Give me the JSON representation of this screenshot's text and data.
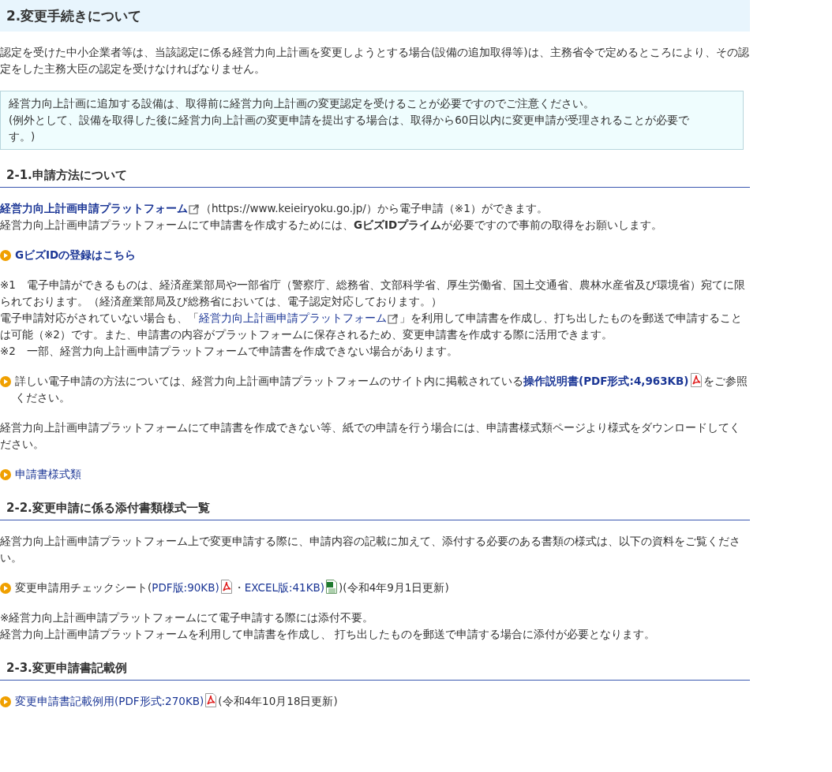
{
  "blocks": [
    {
      "kind": "h2",
      "text": "2.変更手続きについて"
    },
    {
      "kind": "para",
      "lines": [
        [
          {
            "kind": "text",
            "text": "認定を受けた中小企業者等は、当該認定に係る経営力向上計画を変更しようとする場合(設備の追加取得等)は、主務省令で定めるところにより、その認定をした主務大臣の認定を受けなければなりません。"
          }
        ]
      ]
    },
    {
      "kind": "note",
      "lines": [
        [
          {
            "kind": "text",
            "text": "経営力向上計画に追加する設備は、取得前に経営力向上計画の変更認定を受けることが必要ですのでご注意ください。"
          }
        ],
        [
          {
            "kind": "text",
            "text": "(例外として、設備を取得した後に経営力向上計画の変更申請を提出する場合は、取得から60日以内に変更申請が受理されることが必要です。)"
          }
        ]
      ]
    },
    {
      "kind": "h3",
      "text": "2-1.申請方法について"
    },
    {
      "kind": "para",
      "lines": [
        [
          {
            "kind": "link",
            "text": "経営力向上計画申請プラットフォーム",
            "bold": true
          },
          {
            "kind": "external"
          },
          {
            "kind": "text",
            "text": "（https://www.keieiryoku.go.jp/）から電子申請（※1）ができます。"
          }
        ],
        [
          {
            "kind": "text",
            "text": "経営力向上計画申請プラットフォームにて申請書を作成するためには、**GビズIDプライム**が必要ですので事前の取得をお願いします。"
          }
        ]
      ]
    },
    {
      "kind": "bullet",
      "lines": [
        [
          {
            "kind": "link",
            "text": "GビズIDの登録はこちら",
            "bold": true
          }
        ]
      ]
    },
    {
      "kind": "para",
      "lines": [
        [
          {
            "kind": "text",
            "text": "※1　電子申請ができるものは、経済産業部局や一部省庁（警察庁、総務省、文部科学省、厚生労働省、国土交通省、農林水産省及び環境省）宛てに限られております。（経済産業部局及び総務省においては、電子認定対応しております。）"
          }
        ],
        [
          {
            "kind": "text",
            "text": "電子申請対応がされていない場合も、「"
          },
          {
            "kind": "link",
            "text": "経営力向上計画申請プラットフォーム",
            "bold": false
          },
          {
            "kind": "external"
          },
          {
            "kind": "text",
            "text": "」を利用して申請書を作成し、打ち出したものを郵送で申請することは可能（※2）です。また、申請書の内容がプラットフォームに保存されるため、変更申請書を作成する際に活用できます。"
          }
        ],
        [
          {
            "kind": "text",
            "text": "※2　一部、経営力向上計画申請プラットフォームで申請書を作成できない場合があります。"
          }
        ]
      ]
    },
    {
      "kind": "bullet",
      "lines": [
        [
          {
            "kind": "text",
            "text": "詳しい電子申請の方法については、経営力向上計画申請プラットフォームのサイト内に掲載されている"
          },
          {
            "kind": "link",
            "text": "操作説明書(PDF形式:4,963KB)",
            "bold": true
          },
          {
            "kind": "pdf"
          },
          {
            "kind": "text",
            "text": "をご参照ください。"
          }
        ]
      ]
    },
    {
      "kind": "para",
      "lines": [
        [
          {
            "kind": "text",
            "text": "経営力向上計画申請プラットフォームにて申請書を作成できない等、紙での申請を行う場合には、申請書様式類ページより様式をダウンロードしてください。"
          }
        ]
      ]
    },
    {
      "kind": "bullet",
      "lines": [
        [
          {
            "kind": "link",
            "text": "申請書様式類",
            "bold": false
          }
        ]
      ]
    },
    {
      "kind": "h3",
      "text": "2-2.変更申請に係る添付書類様式一覧"
    },
    {
      "kind": "para",
      "lines": [
        [
          {
            "kind": "text",
            "text": "経営力向上計画申請プラットフォーム上で変更申請する際に、申請内容の記載に加えて、添付する必要のある書類の様式は、以下の資料をご覧ください。"
          }
        ]
      ]
    },
    {
      "kind": "bullet",
      "lines": [
        [
          {
            "kind": "text",
            "text": "変更申請用チェックシート("
          },
          {
            "kind": "link",
            "text": "PDF版:90KB)",
            "bold": false
          },
          {
            "kind": "pdf"
          },
          {
            "kind": "text",
            "text": "・"
          },
          {
            "kind": "link",
            "text": "EXCEL版:41KB)",
            "bold": false
          },
          {
            "kind": "excel"
          },
          {
            "kind": "text",
            "text": ")(令和4年9月1日更新)"
          }
        ]
      ]
    },
    {
      "kind": "para",
      "lines": [
        [
          {
            "kind": "text",
            "text": "※経営力向上計画申請プラットフォームにて電子申請する際には添付不要。"
          }
        ],
        [
          {
            "kind": "text",
            "text": "経営力向上計画申請プラットフォームを利用して申請書を作成し、 打ち出したものを郵送で申請する場合に添付が必要となります。"
          }
        ]
      ]
    },
    {
      "kind": "h3",
      "text": "2-3.変更申請書記載例"
    },
    {
      "kind": "bullet",
      "lines": [
        [
          {
            "kind": "link",
            "text": "変更申請書記載例用(PDF形式:270KB)",
            "bold": false
          },
          {
            "kind": "pdf"
          },
          {
            "kind": "text",
            "text": "(令和4年10月18日更新)"
          }
        ]
      ]
    }
  ]
}
